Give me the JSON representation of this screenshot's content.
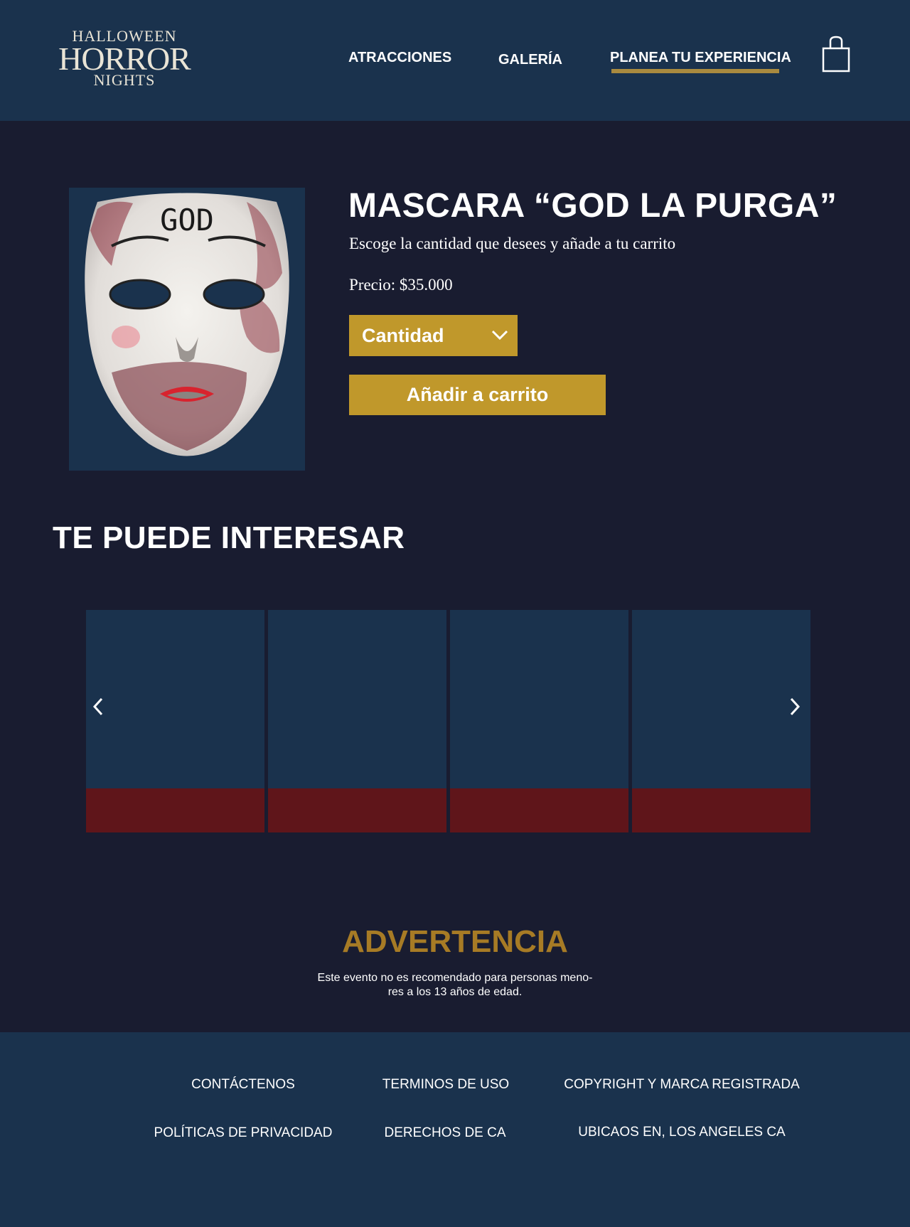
{
  "logo": {
    "line1": "HALLOWEEN",
    "line2": "HORROR",
    "line3": "NIGHTS"
  },
  "nav": {
    "items": [
      {
        "label": "ATRACCIONES"
      },
      {
        "label": "GALERÍA"
      },
      {
        "label": "PLANEA TU EXPERIENCIA",
        "active": true
      }
    ],
    "cart_icon": "shopping-bag-icon"
  },
  "product": {
    "title": "MASCARA “GOD LA PURGA”",
    "subtitle": "Escoge la cantidad que desees y añade a tu carrito",
    "price": "Precio: $35.000",
    "mask_text": "GOD",
    "quantity_label": "Cantidad",
    "add_to_cart_label": "Añadir a carrito"
  },
  "recommended": {
    "title": "TE PUEDE INTERESAR",
    "cards_count_visible": 4,
    "prev_icon": "chevron-left-icon",
    "next_icon": "chevron-right-icon"
  },
  "warning": {
    "title": "ADVERTENCIA",
    "line1": "Este evento no es recomendado para personas meno-",
    "line2": "res a los 13 años de edad."
  },
  "footer": {
    "links": [
      "CONTÁCTENOS",
      "TERMINOS DE USO",
      "COPYRIGHT Y MARCA REGISTRADA",
      "POLÍTICAS DE PRIVACIDAD",
      "DERECHOS DE CA",
      "UBICAOS EN, LOS ANGELES CA"
    ]
  },
  "colors": {
    "background": "#191c30",
    "header": "#1a324d",
    "accent_gold": "#c0982b",
    "warning_gold": "#a77b25",
    "card_band": "#5f151a"
  }
}
